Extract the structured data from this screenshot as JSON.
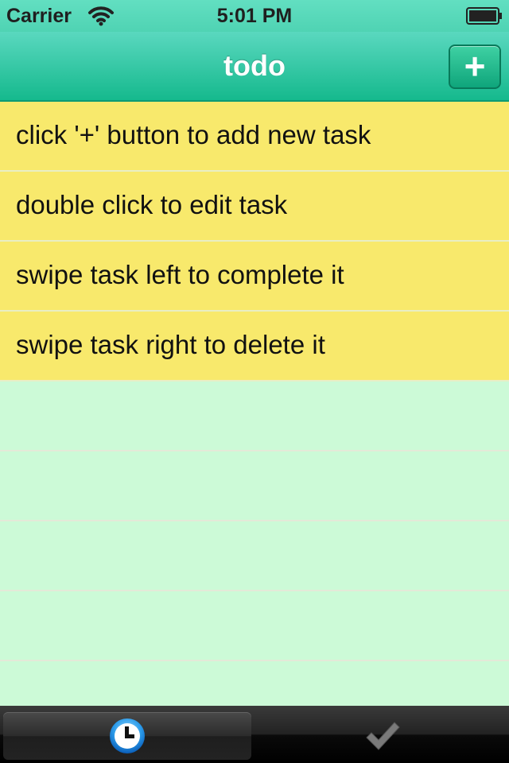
{
  "status_bar": {
    "carrier": "Carrier",
    "time": "5:01 PM",
    "icons": [
      "wifi-icon",
      "battery-icon"
    ]
  },
  "nav_bar": {
    "title": "todo",
    "add_button_label": "+"
  },
  "tasks": [
    {
      "text": "click '+' button to add new task"
    },
    {
      "text": "double click to edit task"
    },
    {
      "text": "swipe task left to complete it"
    },
    {
      "text": "swipe task right to delete it"
    }
  ],
  "tab_bar": {
    "tabs": [
      {
        "icon": "clock-icon",
        "selected": true
      },
      {
        "icon": "checkmark-icon",
        "selected": false
      }
    ]
  },
  "colors": {
    "nav_green": "#15b98d",
    "task_yellow": "#f8e96c",
    "empty_mint": "#ccfad7",
    "tab_bar_black": "#000000"
  }
}
